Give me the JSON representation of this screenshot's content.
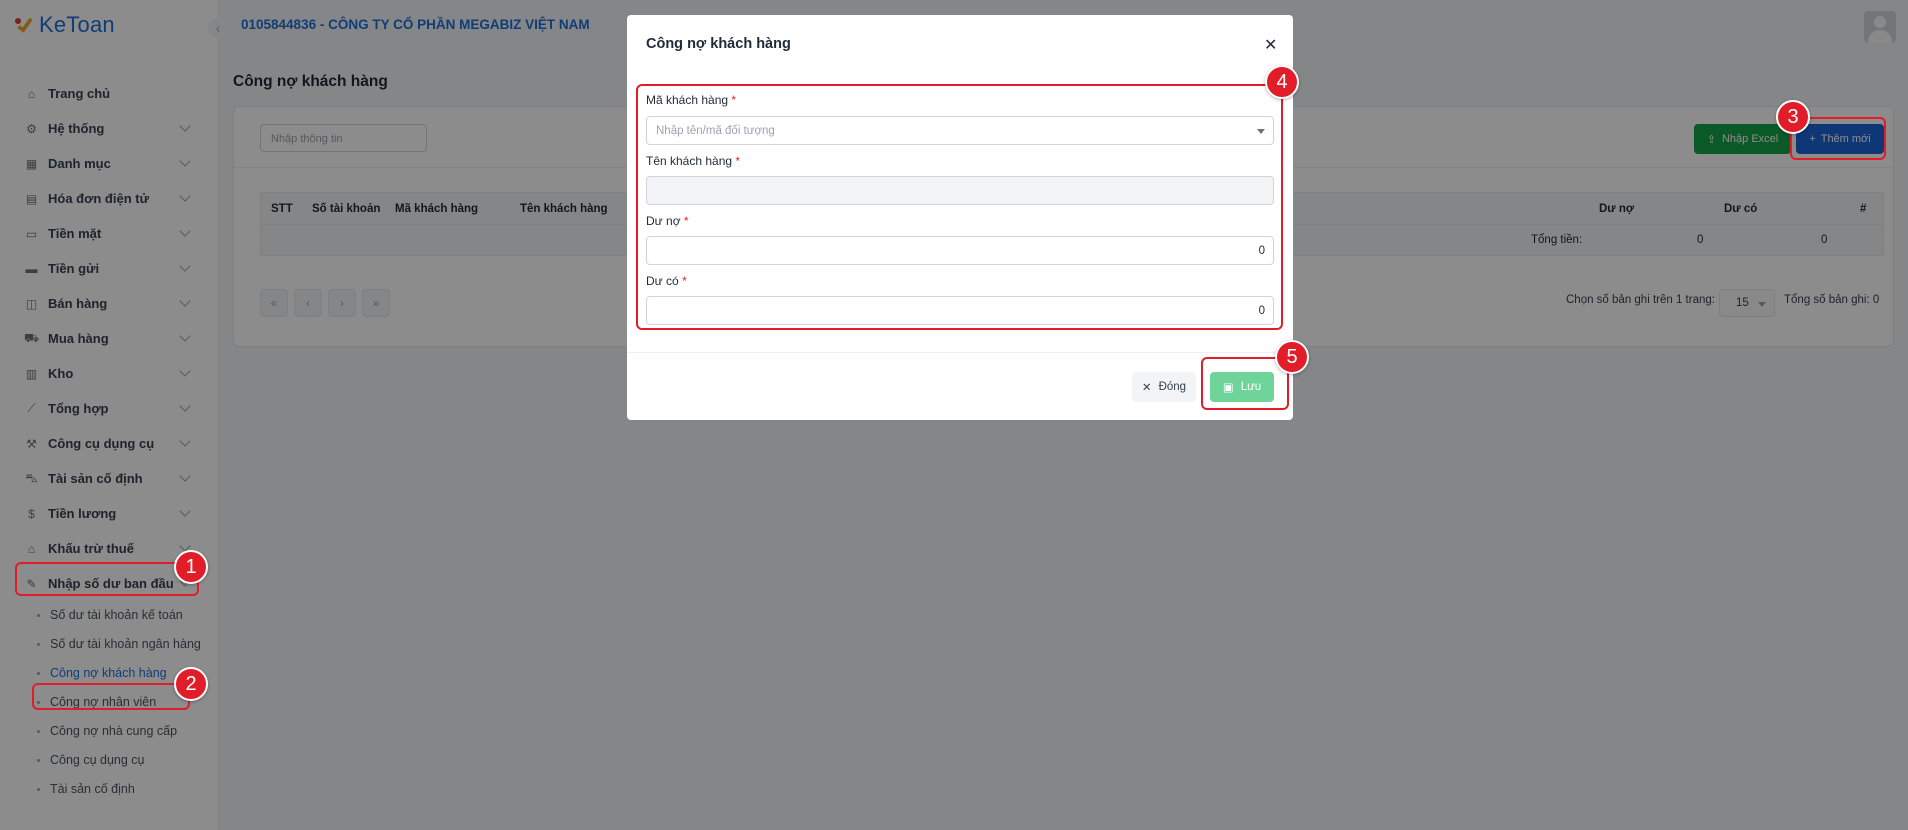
{
  "app": {
    "logo_text": "KeToan",
    "company": "0105844836 - CÔNG TY CỔ PHẦN MEGABIZ VIỆT NAM"
  },
  "sidebar": {
    "items": [
      {
        "label": "Trang chủ",
        "icon": "home-icon",
        "glyph": "⌂",
        "chevron": false
      },
      {
        "label": "Hệ thống",
        "icon": "gear-icon",
        "glyph": "⚙",
        "chevron": true
      },
      {
        "label": "Danh mục",
        "icon": "grid-icon",
        "glyph": "▦",
        "chevron": true
      },
      {
        "label": "Hóa đơn điện tử",
        "icon": "invoice-icon",
        "glyph": "▤",
        "chevron": true
      },
      {
        "label": "Tiền mặt",
        "icon": "cash-icon",
        "glyph": "▭",
        "chevron": true
      },
      {
        "label": "Tiền gửi",
        "icon": "card-icon",
        "glyph": "▬",
        "chevron": true
      },
      {
        "label": "Bán hàng",
        "icon": "bag-icon",
        "glyph": "◫",
        "chevron": true
      },
      {
        "label": "Mua hàng",
        "icon": "cart-icon",
        "glyph": "⛟",
        "chevron": true
      },
      {
        "label": "Kho",
        "icon": "warehouse-icon",
        "glyph": "▥",
        "chevron": true
      },
      {
        "label": "Tổng hợp",
        "icon": "chart-icon",
        "glyph": "⟋",
        "chevron": true
      },
      {
        "label": "Công cụ dụng cụ",
        "icon": "tools-icon",
        "glyph": "⚒",
        "chevron": true
      },
      {
        "label": "Tài sản cố định",
        "icon": "asset-icon",
        "glyph": "⛍",
        "chevron": true
      },
      {
        "label": "Tiền lương",
        "icon": "salary-icon",
        "glyph": "$",
        "chevron": true
      },
      {
        "label": "Khấu trừ thuế",
        "icon": "bank-icon",
        "glyph": "⌂",
        "chevron": true
      },
      {
        "label": "Nhập số dư ban đầu",
        "icon": "edit-icon",
        "glyph": "✎",
        "chevron": true
      }
    ],
    "subitems": [
      {
        "label": "Số dư tài khoản kế toán",
        "active": false
      },
      {
        "label": "Số dư tài khoản ngân hàng",
        "active": false
      },
      {
        "label": "Công nợ khách hàng",
        "active": true
      },
      {
        "label": "Công nợ nhân viên",
        "active": false
      },
      {
        "label": "Công nợ nhà cung cấp",
        "active": false
      },
      {
        "label": "Công cụ dụng cụ",
        "active": false
      },
      {
        "label": "Tài sản cố định",
        "active": false
      }
    ]
  },
  "page": {
    "title": "Công nợ khách hàng",
    "search_placeholder": "Nhập thông tin",
    "import_excel_label": "Nhập Excel",
    "add_new_label": "Thêm mới",
    "table": {
      "headers": {
        "stt": "STT",
        "account": "Số tài khoản",
        "customer_code": "Mã khách hàng",
        "customer_name": "Tên khách hàng",
        "debit": "Dư nợ",
        "credit": "Dư có",
        "actions": "#"
      },
      "total_label": "Tổng tiền:",
      "total_debit": "0",
      "total_credit": "0"
    },
    "pagination": {
      "per_page_label": "Chọn số bản ghi trên 1 trang:",
      "per_page_value": "15",
      "total_records": "Tổng số bản ghi: 0"
    }
  },
  "modal": {
    "title": "Công nợ khách hàng",
    "fields": {
      "customer_code_label": "Mã khách hàng",
      "customer_code_placeholder": "Nhập tên/mã đối tượng",
      "customer_name_label": "Tên khách hàng",
      "debit_label": "Dư nợ",
      "debit_value": "0",
      "credit_label": "Dư có",
      "credit_value": "0"
    },
    "required_mark": "*",
    "close_label": "Đóng",
    "save_label": "Lưu"
  },
  "annotations": [
    "1",
    "2",
    "3",
    "4",
    "5"
  ],
  "colors": {
    "brand": "#1e6fd9",
    "add_button": "#1d64d8",
    "excel_button": "#16a34a",
    "save_button": "#6fd49a",
    "annotation": "#e11d2a"
  }
}
